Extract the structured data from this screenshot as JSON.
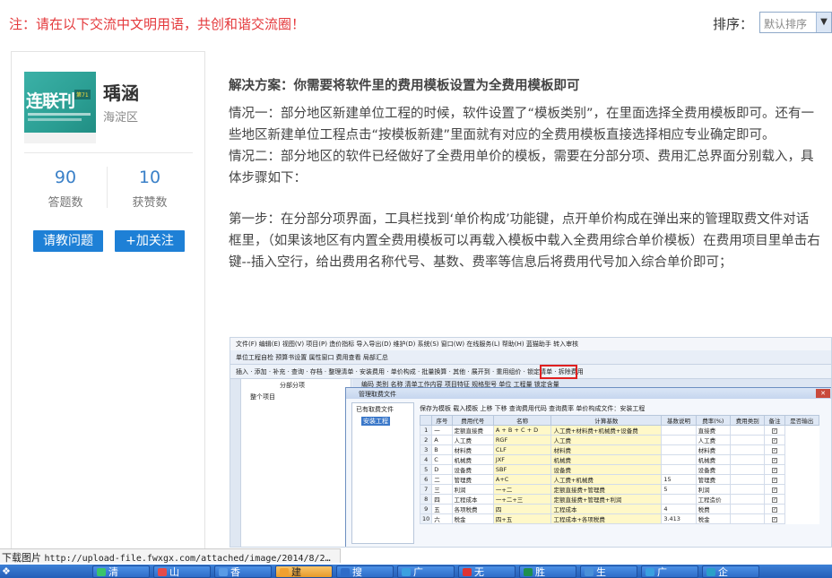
{
  "notice": "注：请在以下交流中文明用语，共创和谐交流圈！",
  "sort": {
    "label": "排序：",
    "selected": "默认排序"
  },
  "profile": {
    "avatar_text": "连联刊",
    "avatar_tag": "第71",
    "name": "瑀涵",
    "location": "海淀区",
    "answers": {
      "value": "90",
      "label": "答题数"
    },
    "likes": {
      "value": "10",
      "label": "获赞数"
    },
    "ask_button": "请教问题",
    "follow_button": "+加关注"
  },
  "answer": {
    "heading": "解决方案：你需要将软件里的费用模板设置为全费用模板即可",
    "paragraphs": [
      "情况一：部分地区新建单位工程的时候，软件设置了“模板类别”，在里面选择全费用模板即可。还有一些地区新建单位工程点击“按模板新建”里面就有对应的全费用模板直接选择相应专业确定即可。",
      "情况二：部分地区的软件已经做好了全费用单价的模板，需要在分部分项、费用汇总界面分别载入，具体步骤如下：",
      "第一步：在分部分项界面，工具栏找到‘单价构成’功能键，点开单价构成在弹出来的管理取费文件对话框里，（如果该地区有内置全费用模板可以再载入模板中载入全费用综合单价模板）在费用项目里单击右键--插入空行，给出费用名称代号、基数、费率等信息后将费用代号加入综合单价即可；"
    ]
  },
  "screenshot": {
    "menubar": "文件(F)  编辑(E)  视图(V)  项目(P)  造价指标  导入导出(D)  维护(D)  系统(S)  窗口(W)  在线服务(L)  帮助(H)  蓝猫助手  转入审核",
    "toolbar1": "单位工程自检   预算书设置   属性窗口   费用查看   局部汇总",
    "toolbar2": "插入 · 添加 · 补充 · 查询 · 存档 · 整理清单 · 安装费用 · 单价构成 · 批量换算 · 其他 · 展开到 · 重用组价 · 锁定清单 · 拆除费用",
    "left_pane_title": "分部分项",
    "left_pane_item": "整个项目",
    "grid_head": "编码      类别      名称              清单工作内容    项目特征   规格型号   单位   工程量   锁定含量",
    "dialog": {
      "title": "管理取费文件",
      "left_title": "已有取费文件",
      "left_item": "安装工程",
      "tools": "保存为模板   载入模板   上移   下移   查询费用代码   查询费率        单价构成文件：安装工程",
      "columns": [
        "序号",
        "费用代号",
        "名称",
        "计算基数",
        "基数说明",
        "费率(%)",
        "费用类别",
        "备注",
        "是否输出"
      ],
      "rows": [
        [
          "1",
          "一",
          "一",
          "定额直接费",
          "A + B + C + D",
          "人工费+材料费+机械费+设备费",
          "",
          "直接费",
          "",
          "✓"
        ],
        [
          "2",
          "A",
          "A",
          "人工费",
          "RGF",
          "人工费",
          "",
          "人工费",
          "",
          "✓"
        ],
        [
          "3",
          "B",
          "B",
          "材料费",
          "CLF",
          "材料费",
          "",
          "材料费",
          "",
          "✓"
        ],
        [
          "4",
          "C",
          "C",
          "机械费",
          "JXF",
          "机械费",
          "",
          "机械费",
          "",
          "✓"
        ],
        [
          "5",
          "D",
          "D",
          "设备费",
          "SBF",
          "设备费",
          "",
          "设备费",
          "",
          "✓"
        ],
        [
          "6",
          "二",
          "二",
          "管理费",
          "A+C",
          "人工费+机械费",
          "15",
          "管理费",
          "",
          "✓"
        ],
        [
          "7",
          "三",
          "三",
          "利润",
          "一+二",
          "定额直接费+管理费",
          "5",
          "利润",
          "",
          "✓"
        ],
        [
          "8",
          "四",
          "四",
          "工程成本",
          "一+二+三",
          "定额直接费+管理费+利润",
          "",
          "工程造价",
          "",
          "✓"
        ],
        [
          "9",
          "五",
          "五",
          "各项税费",
          "四",
          "工程成本",
          "4",
          "税费",
          "",
          "✓"
        ],
        [
          "10",
          "六",
          "六",
          "税金",
          "四+五",
          "工程成本+各项税费",
          "3.413",
          "税金",
          "",
          "✓"
        ]
      ]
    }
  },
  "status_bar": {
    "label": "下载图片",
    "url": "http://upload-file.fwxgx.com/attached/image/2014/8/2…"
  },
  "taskbar": {
    "items": [
      "清",
      "山",
      "香",
      "建",
      "搜",
      "广",
      "无",
      "胜",
      "生",
      "广",
      "企"
    ]
  }
}
